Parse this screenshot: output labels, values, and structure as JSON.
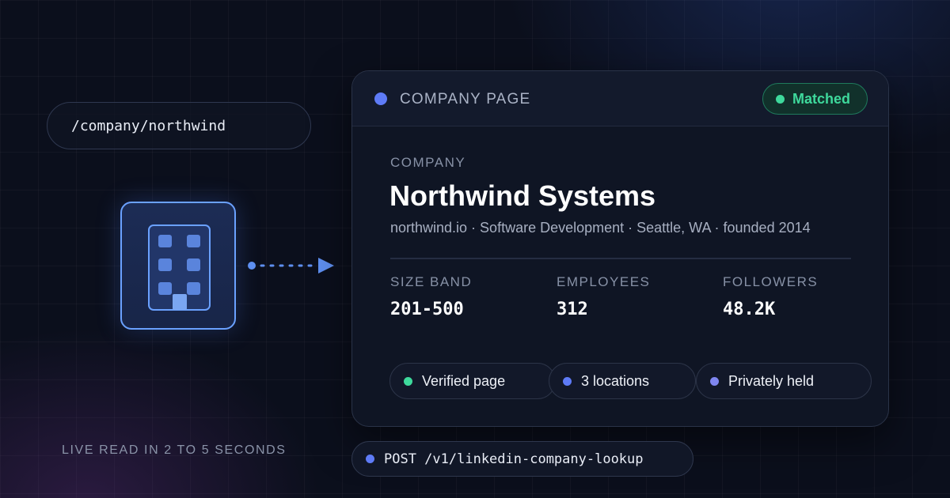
{
  "path_pill": {
    "text": "/company/northwind"
  },
  "icons": {
    "building": "building-icon",
    "arrow": "dotted-arrow-icon"
  },
  "card": {
    "header_title": "COMPANY PAGE",
    "status_badge": "Matched",
    "eyebrow": "COMPANY",
    "company_name": "Northwind Systems",
    "subline": "northwind.io · Software Development · Seattle, WA · founded 2014",
    "stats": [
      {
        "label": "SIZE BAND",
        "value": "201-500"
      },
      {
        "label": "EMPLOYEES",
        "value": "312"
      },
      {
        "label": "FOLLOWERS",
        "value": "48.2K"
      }
    ],
    "tags": [
      {
        "label": "Verified page",
        "dot_color": "#3ed99c"
      },
      {
        "label": "3 locations",
        "dot_color": "#5e7bf6"
      },
      {
        "label": "Privately held",
        "dot_color": "#7f86f0"
      }
    ]
  },
  "footer": {
    "live_text": "LIVE READ IN 2 TO 5 SECONDS",
    "endpoint": "POST /v1/linkedin-company-lookup"
  },
  "colors": {
    "accent_blue": "#5e7bf6",
    "success_green": "#3ed99c",
    "background": "#0b0f1c"
  }
}
